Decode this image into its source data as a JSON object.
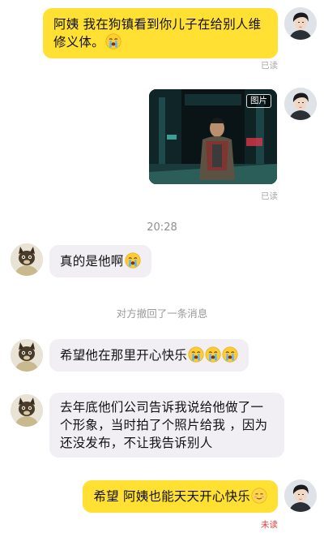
{
  "messages": {
    "msg1": {
      "text": "阿姨 我在狗镇看到你儿子在给别人维修义体。",
      "emoji": "crying-face-emoji",
      "status": "已读"
    },
    "msg2": {
      "type": "image",
      "tag": "图片",
      "status": "已读"
    },
    "time": "20:28",
    "msg3": {
      "text": "真的是他啊",
      "emoji": "crying-face-emoji"
    },
    "recall": "对方撤回了一条消息",
    "msg4": {
      "text": "希望他在那里开心快乐",
      "emoji": "crying-face-emoji"
    },
    "msg5": {
      "text": "去年底他们公司告诉我说给他做了一个形象，当时拍了个照片给我 ，因为还没发布，不让我告诉别人"
    },
    "msg6": {
      "text": "希望 阿姨也能天天开心快乐",
      "emoji": "smiling-face-emoji",
      "status": "未读"
    }
  },
  "colors": {
    "outgoing_bubble": "#ffe033",
    "incoming_bubble": "#f1eff3",
    "read_status": "#a6a6a6",
    "unread_status": "#e6423a"
  }
}
